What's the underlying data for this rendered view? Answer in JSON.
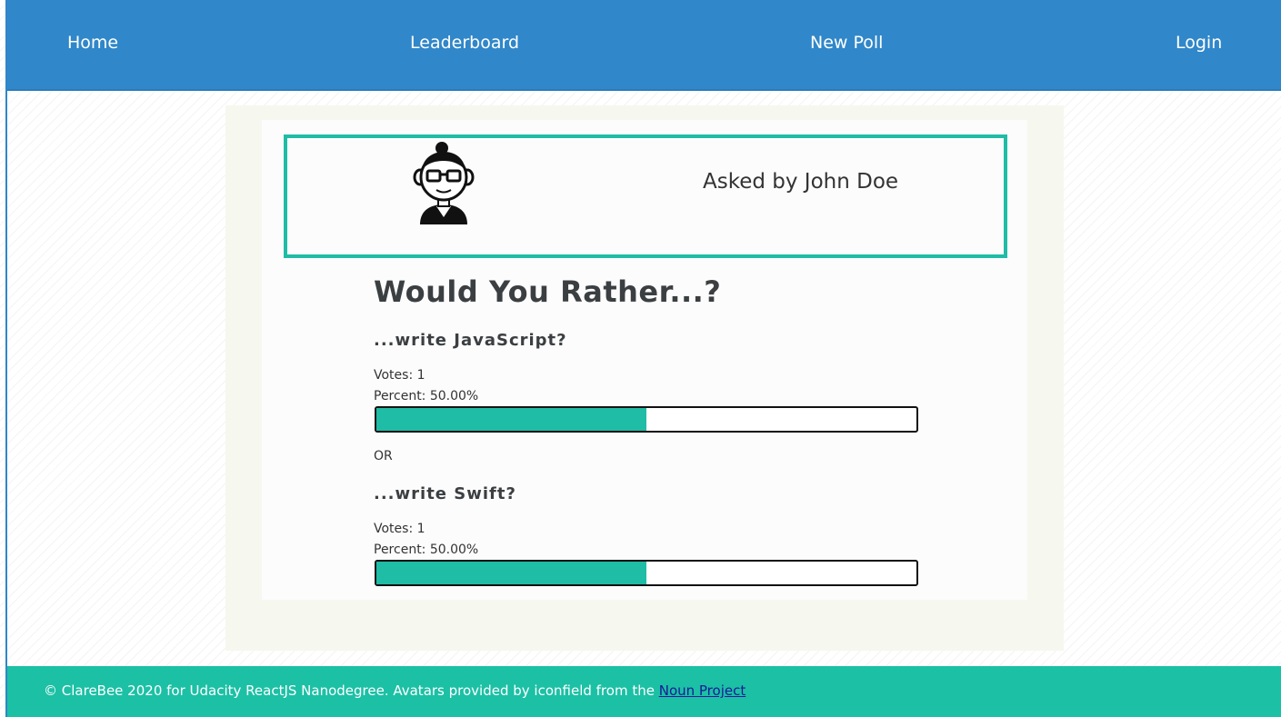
{
  "nav": {
    "items": [
      {
        "label": "Home"
      },
      {
        "label": "Leaderboard"
      },
      {
        "label": "New Poll"
      },
      {
        "label": "Login"
      }
    ]
  },
  "question": {
    "author_text": "Asked by John Doe",
    "avatar_icon": "avatar-icon",
    "title": "Would You Rather...?",
    "separator": "OR",
    "options": [
      {
        "text": "...write JavaScript?",
        "votes": "Votes: 1",
        "percent": "Percent: 50.00%",
        "fill": 0.5
      },
      {
        "text": "...write Swift?",
        "votes": "Votes: 1",
        "percent": "Percent: 50.00%",
        "fill": 0.5
      }
    ]
  },
  "footer": {
    "text": "© ClareBee 2020 for Udacity ReactJS Nanodegree. Avatars provided by iconfield from the ",
    "link_label": "Noun Project"
  },
  "colors": {
    "nav": "#3087c9",
    "accent": "#1fbca6",
    "footer": "#1cc0a5"
  }
}
